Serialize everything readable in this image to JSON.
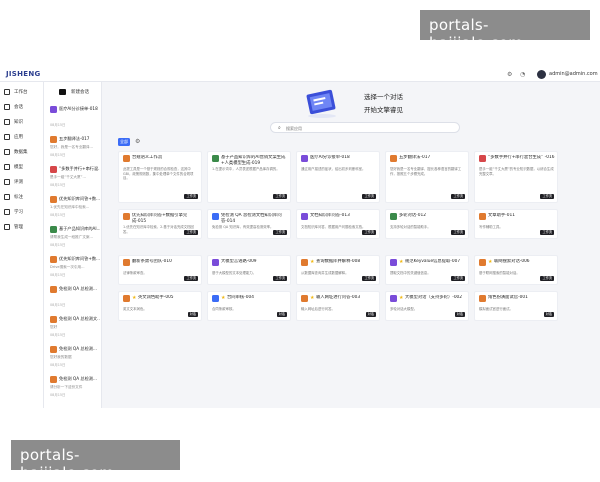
{
  "watermark": {
    "text": "portals-baijiale.com"
  },
  "app": {
    "logo": "JISHENG",
    "user_email": "admin@admin.com"
  },
  "nav": {
    "items": [
      {
        "label": "工作台",
        "icon": "home-icon"
      },
      {
        "label": "会话",
        "icon": "chat-icon"
      },
      {
        "label": "知识",
        "icon": "book-icon"
      },
      {
        "label": "应用",
        "icon": "grid-icon"
      },
      {
        "label": "数据集",
        "icon": "database-icon"
      },
      {
        "label": "模型",
        "icon": "cube-icon"
      },
      {
        "label": "评测",
        "icon": "chart-icon"
      },
      {
        "label": "标注",
        "icon": "tag-icon"
      },
      {
        "label": "学习",
        "icon": "cap-icon"
      },
      {
        "label": "管理",
        "icon": "gear-icon"
      }
    ]
  },
  "history": {
    "new_chat": "新建会话",
    "items": [
      {
        "title": "医疗AI分诊接单-018",
        "subtitle": "",
        "date": "08月15日",
        "color": "#7a4cd9"
      },
      {
        "title": "五步翻译法-017",
        "subtitle": "您好，我是一名专业翻译...",
        "date": "08月15日",
        "color": "#e07a2f"
      },
      {
        "title": "“多数手并行+串行混...",
        "subtitle": "是手一组“千丈大厦”...",
        "date": "08月15日",
        "color": "#d6474a"
      },
      {
        "title": "优先知识库问答+数...",
        "subtitle": "1.优先在知识库中检索...",
        "date": "08月15日",
        "color": "#e07a2f"
      },
      {
        "title": "基于产品知识库的AI...",
        "subtitle": "请帮我生成一段推广文案...",
        "date": "08月15日",
        "color": "#3b8a4a"
      },
      {
        "title": "优先知识库问答+数...",
        "subtitle": "Drive搜索一次引用...",
        "date": "08月15日",
        "color": "#e07a2f"
      },
      {
        "title": "免检测 QA 总检测...",
        "subtitle": "",
        "date": "08月15日",
        "color": "#e07a2f"
      },
      {
        "title": "免检测 QA 总检测文...",
        "subtitle": "您好",
        "date": "08月15日",
        "color": "#e07a2f"
      },
      {
        "title": "免检测 QA 总检测...",
        "subtitle": "您好我的数据",
        "date": "08月15日",
        "color": "#e07a2f"
      },
      {
        "title": "免检测 QA 总检测...",
        "subtitle": "请分析一下这份文件",
        "date": "08月15日",
        "color": "#e07a2f"
      }
    ]
  },
  "hero": {
    "line1": "选择一个对话",
    "line2": "开始文擎睿见"
  },
  "search": {
    "placeholder": "搜索应用"
  },
  "tabs": {
    "all": "全部"
  },
  "cards": [
    {
      "title": "合规语义工作流",
      "desc": "此提工具是一个基于规则的合规检查，这其中GBI，政策规则数，集中处理单个文件的合规项目。",
      "badge": "工作流",
      "color": "#e07a2f",
      "star": false
    },
    {
      "title": "基于产品知识库的AI营销文案生成+人类模型生成-019",
      "desc": "1.在提示词中，人员表述根据产品库存调的。",
      "badge": "工作流",
      "color": "#3b8a4a",
      "star": false
    },
    {
      "title": "医疗AI分诊接单-018",
      "desc": "通过用户描述的症状，给出初步判断科室。",
      "badge": "工作流",
      "color": "#7a4cd9",
      "star": false
    },
    {
      "title": "五步翻译法-017",
      "desc": "您好我是一名专业翻译，擅长各种语言的翻译工作，按照五个步骤完成。",
      "badge": "工作流",
      "color": "#e07a2f",
      "star": false
    },
    {
      "title": "“多数手并行+串行混合生成” -016",
      "desc": "是手一组“千丈大厦”的专业知识数据，以综合生成完整文章。",
      "badge": "工作流",
      "color": "#d6474a",
      "star": false
    },
    {
      "title": "优先知识库问答+数据引擎完成-015",
      "desc": "1.优先在知识库中检索，2.基于对话完成文档回答。",
      "badge": "工作流",
      "color": "#e07a2f",
      "star": false
    },
    {
      "title": "免检测 QA 总检测文档知识库问答-014",
      "desc": "免检测 QA 知识库，有效提高检测效率。",
      "badge": "工作流",
      "color": "#3b6cf6",
      "star": false
    },
    {
      "title": "文档知识库问答-013",
      "desc": "文档知识库问答，根据用户问题检索文档。",
      "badge": "工作流",
      "color": "#7a4cd9",
      "star": false
    },
    {
      "title": "多轮对话-012",
      "desc": "支持多轮对话的智能助手。",
      "badge": "工作流",
      "color": "#3b8a4a",
      "star": false
    },
    {
      "title": "文章助手-011",
      "desc": "写作辅助工具。",
      "badge": "工作流",
      "color": "#e07a2f",
      "star": false
    },
    {
      "title": "翻新条款号团队-010",
      "desc": "法律条款审查。",
      "badge": "工作流",
      "color": "#e07a2f",
      "star": false
    },
    {
      "title": "大模型言语路-009",
      "desc": "基于大模型的文本处理能力。",
      "badge": "工作流",
      "color": "#7a4cd9",
      "star": false
    },
    {
      "title": "查询数据库并解释-008",
      "desc": "从数据库查询并生成数据解释。",
      "badge": "工作流",
      "color": "#e07a2f",
      "star": true
    },
    {
      "title": "规范Keyvalue信息提取-007",
      "desc": "提取文档中的关键值信息。",
      "badge": "工作流",
      "color": "#7a4cd9",
      "star": true
    },
    {
      "title": "联网搜索对话-006",
      "desc": "基于联网搜索的智能对话。",
      "badge": "工作流",
      "color": "#e07a2f",
      "star": true
    },
    {
      "title": "英文润色助手-005",
      "desc": "英文文本润色。",
      "badge": "对话",
      "color": "#e07a2f",
      "star": true
    },
    {
      "title": "合同审核-004",
      "desc": "合同条款审核。",
      "badge": "对话",
      "color": "#3b6cf6",
      "star": true
    },
    {
      "title": "输入网址进行问答-003",
      "desc": "输入网址后进行问答。",
      "badge": "对话",
      "color": "#e07a2f",
      "star": true
    },
    {
      "title": "大模型对话（支持多轮）-002",
      "desc": "多轮对话大模型。",
      "badge": "对话",
      "color": "#7a4cd9",
      "star": true
    },
    {
      "title": "角色扮演面试官-001",
      "desc": "模拟面试官进行面试。",
      "badge": "对话",
      "color": "#e07a2f",
      "star": false
    }
  ]
}
